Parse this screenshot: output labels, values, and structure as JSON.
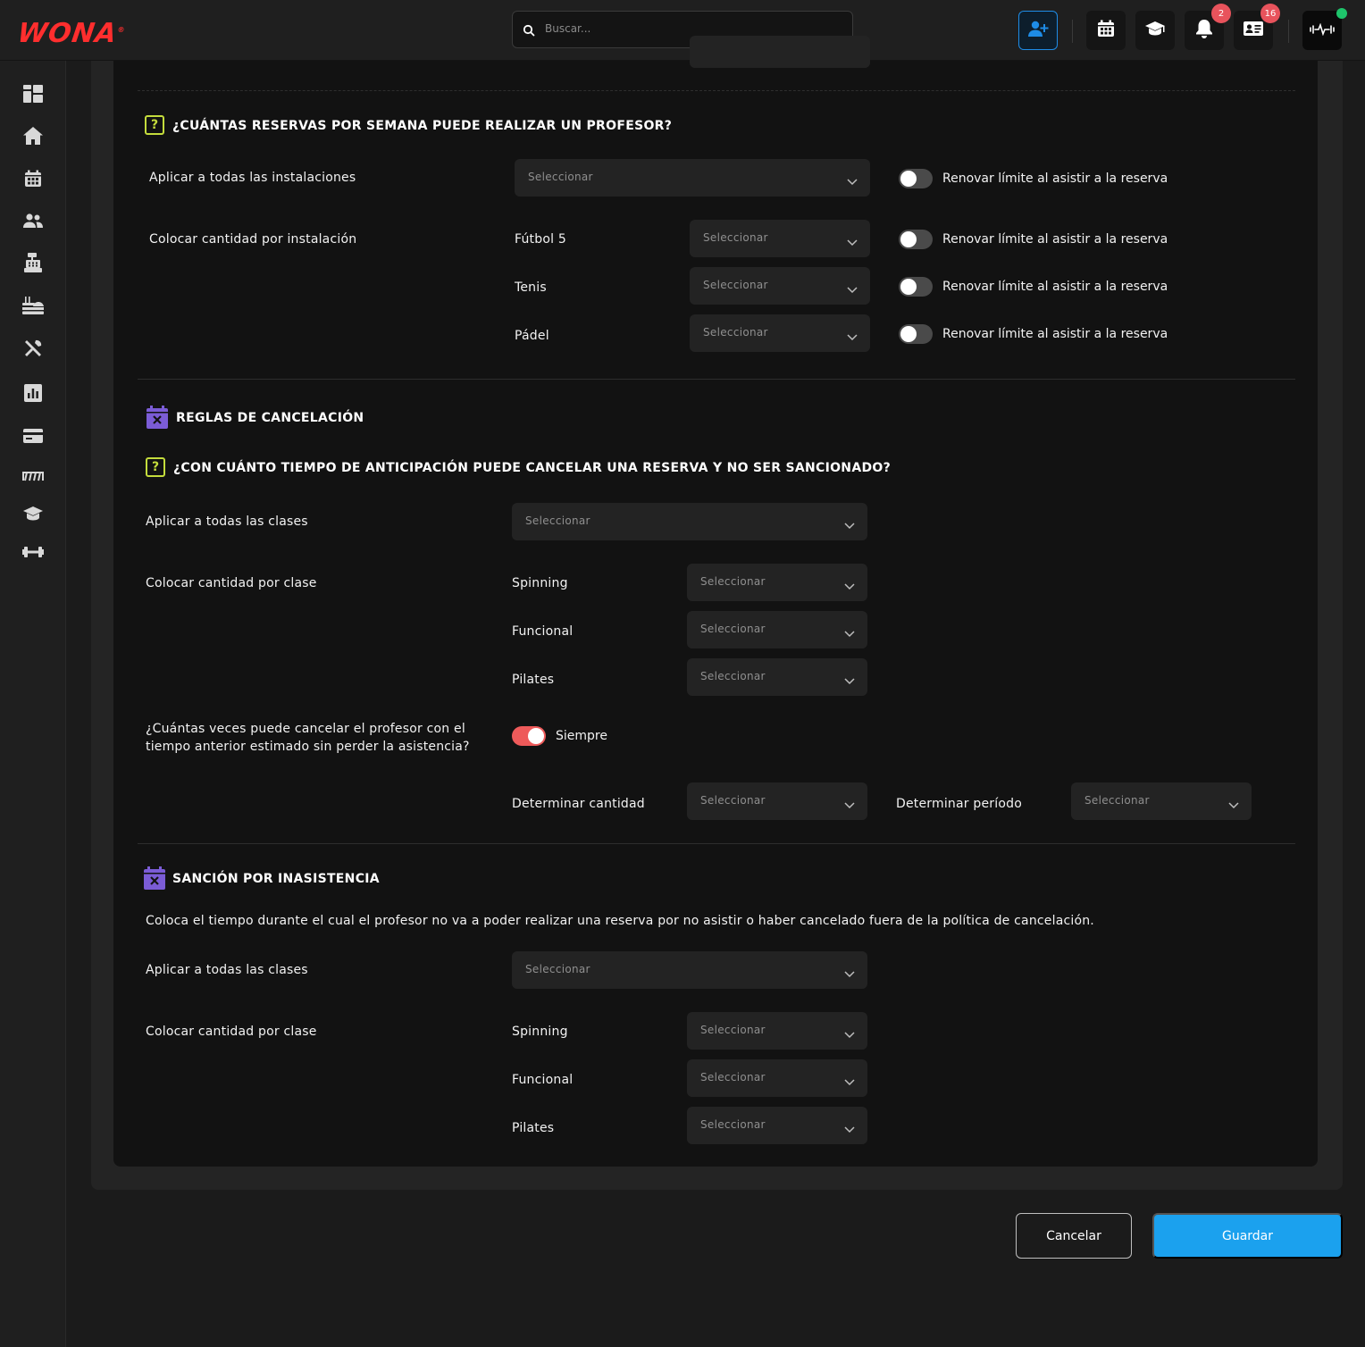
{
  "header": {
    "logo": "WONA",
    "logo_mark": "®",
    "search_placeholder": "Buscar...",
    "notifications_badge": "2",
    "messages_badge": "16",
    "accent": "#1e8ce6"
  },
  "sidebar": {
    "items": [
      "dashboard-icon",
      "home-icon",
      "calendar-icon",
      "users-icon",
      "cash-register-icon",
      "food-icon",
      "tools-icon",
      "chart-icon",
      "card-icon",
      "track-icon",
      "graduation-icon",
      "dumbbell-icon"
    ]
  },
  "reservas": {
    "question": "¿CUÁNTAS RESERVAS POR SEMANA PUEDE REALIZAR UN PROFESOR?",
    "apply_all_label": "Aplicar a todas las instalaciones",
    "per_item_label": "Colocar cantidad por instalación",
    "select_placeholder": "Seleccionar",
    "renew_label": "Renovar límite al asistir a la reserva",
    "items": [
      {
        "name": "Fútbol 5"
      },
      {
        "name": "Tenis"
      },
      {
        "name": "Pádel"
      }
    ]
  },
  "cancelacion": {
    "title": "REGLAS DE CANCELACIÓN",
    "question": "¿CON CUÁNTO TIEMPO DE ANTICIPACIÓN PUEDE CANCELAR UNA RESERVA Y NO SER SANCIONADO?",
    "apply_all_label": "Aplicar a todas las clases",
    "per_item_label": "Colocar cantidad por clase",
    "select_placeholder": "Seleccionar",
    "items": [
      {
        "name": "Spinning"
      },
      {
        "name": "Funcional"
      },
      {
        "name": "Pilates"
      }
    ],
    "times_question_line1": "¿Cuántas veces puede cancelar el profesor con el",
    "times_question_line2": "tiempo anterior estimado sin perder la asistencia?",
    "always_label": "Siempre",
    "always_on": true,
    "amount_label": "Determinar cantidad",
    "period_label": "Determinar período"
  },
  "sancion": {
    "title": "SANCIÓN POR INASISTENCIA",
    "description": "Coloca el tiempo durante el cual el profesor no va a poder realizar una reserva por no asistir o haber cancelado fuera de la política de cancelación.",
    "apply_all_label": "Aplicar a todas las clases",
    "per_item_label": "Colocar cantidad por clase",
    "select_placeholder": "Seleccionar",
    "items": [
      {
        "name": "Spinning"
      },
      {
        "name": "Funcional"
      },
      {
        "name": "Pilates"
      }
    ]
  },
  "footer": {
    "cancel_label": "Cancelar",
    "save_label": "Guardar"
  }
}
